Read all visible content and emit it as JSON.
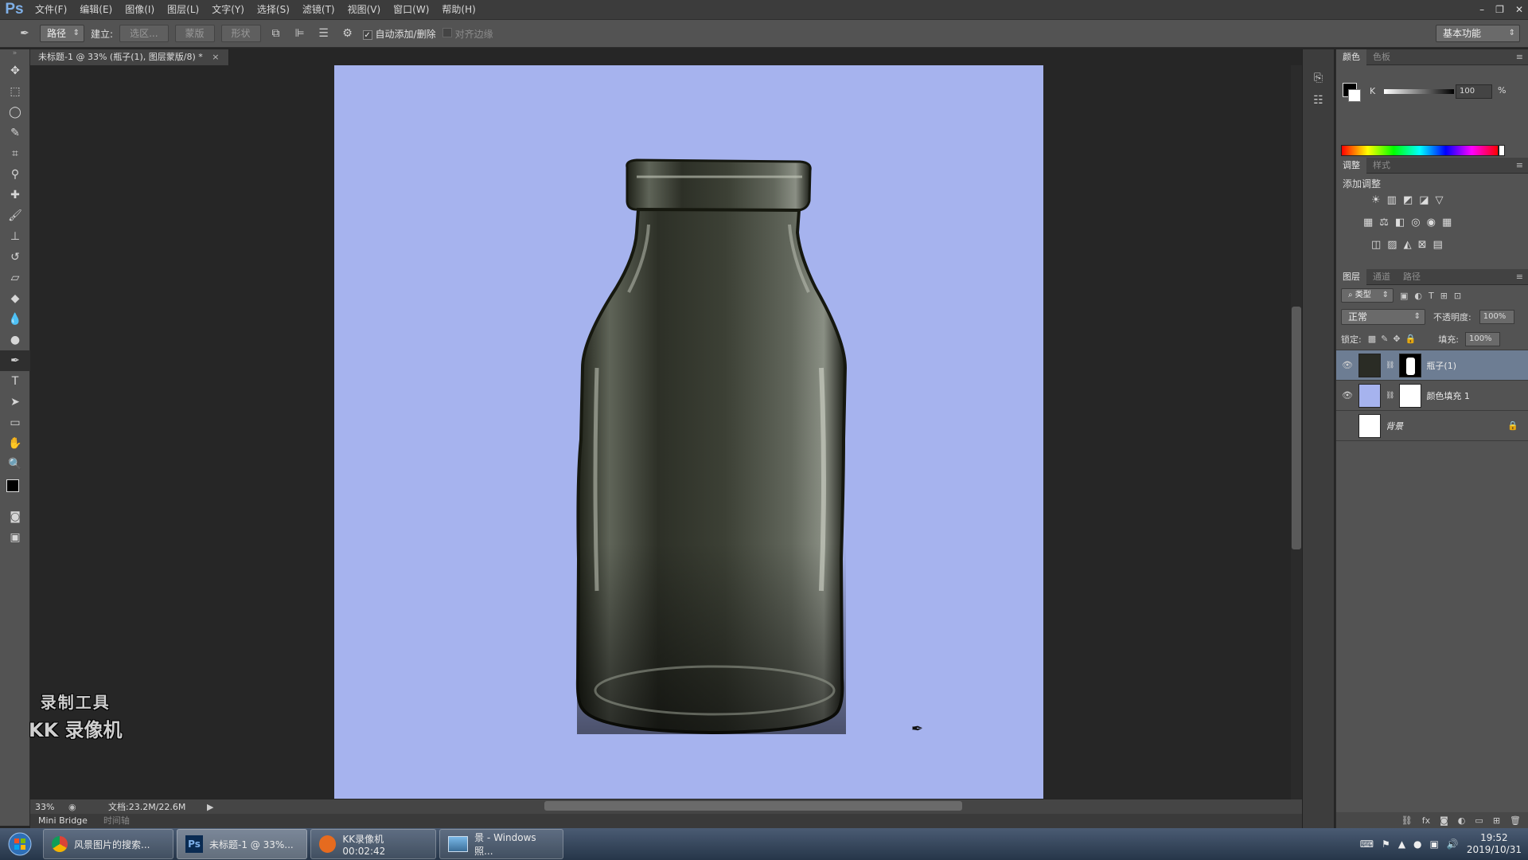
{
  "app": {
    "logo": "Ps"
  },
  "menu": [
    "文件(F)",
    "编辑(E)",
    "图像(I)",
    "图层(L)",
    "文字(Y)",
    "选择(S)",
    "滤镜(T)",
    "视图(V)",
    "窗口(W)",
    "帮助(H)"
  ],
  "window_controls": {
    "minimize": "–",
    "restore": "❐",
    "close": "✕"
  },
  "options": {
    "tool_mode": "路径",
    "make_label": "建立:",
    "make_selection": "选区...",
    "make_mask": "蒙版",
    "make_shape": "形状",
    "auto_add_delete": "自动添加/删除",
    "align_edges": "对齐边缘",
    "workspace": "基本功能"
  },
  "document": {
    "tab_title": "未标题-1 @ 33% (瓶子(1), 图层蒙版/8) *",
    "tab_close": "×",
    "zoom": "33%",
    "doc_size": "文档:23.2M/22.6M",
    "canvas_color": "#a6b3ee"
  },
  "bottom_tabs": [
    "Mini Bridge",
    "时间轴"
  ],
  "watermark": {
    "line1": "录制工具",
    "line2": "KK 录像机"
  },
  "color_panel": {
    "tabs": [
      "颜色",
      "色板"
    ],
    "channel": "K",
    "value": "100",
    "unit": "%"
  },
  "adjust_panel": {
    "tabs": [
      "调整",
      "样式"
    ],
    "title": "添加调整"
  },
  "layers_panel": {
    "tabs": [
      "图层",
      "通道",
      "路径"
    ],
    "filter": "类型",
    "blend_mode": "正常",
    "opacity_label": "不透明度:",
    "opacity": "100%",
    "lock_label": "锁定:",
    "fill_label": "填充:",
    "fill": "100%",
    "layers": [
      {
        "name": "瓶子(1)",
        "selected": true,
        "visible": true,
        "locked": false
      },
      {
        "name": "颜色填充 1",
        "selected": false,
        "visible": true,
        "locked": false
      },
      {
        "name": "背景",
        "selected": false,
        "visible": false,
        "locked": true
      }
    ]
  },
  "taskbar": {
    "tasks": [
      "风景图片的搜索...",
      "未标题-1 @ 33%...",
      "KK录像机 00:02:42",
      "景 - Windows 照..."
    ],
    "time": "19:52",
    "date": "2019/10/31"
  }
}
